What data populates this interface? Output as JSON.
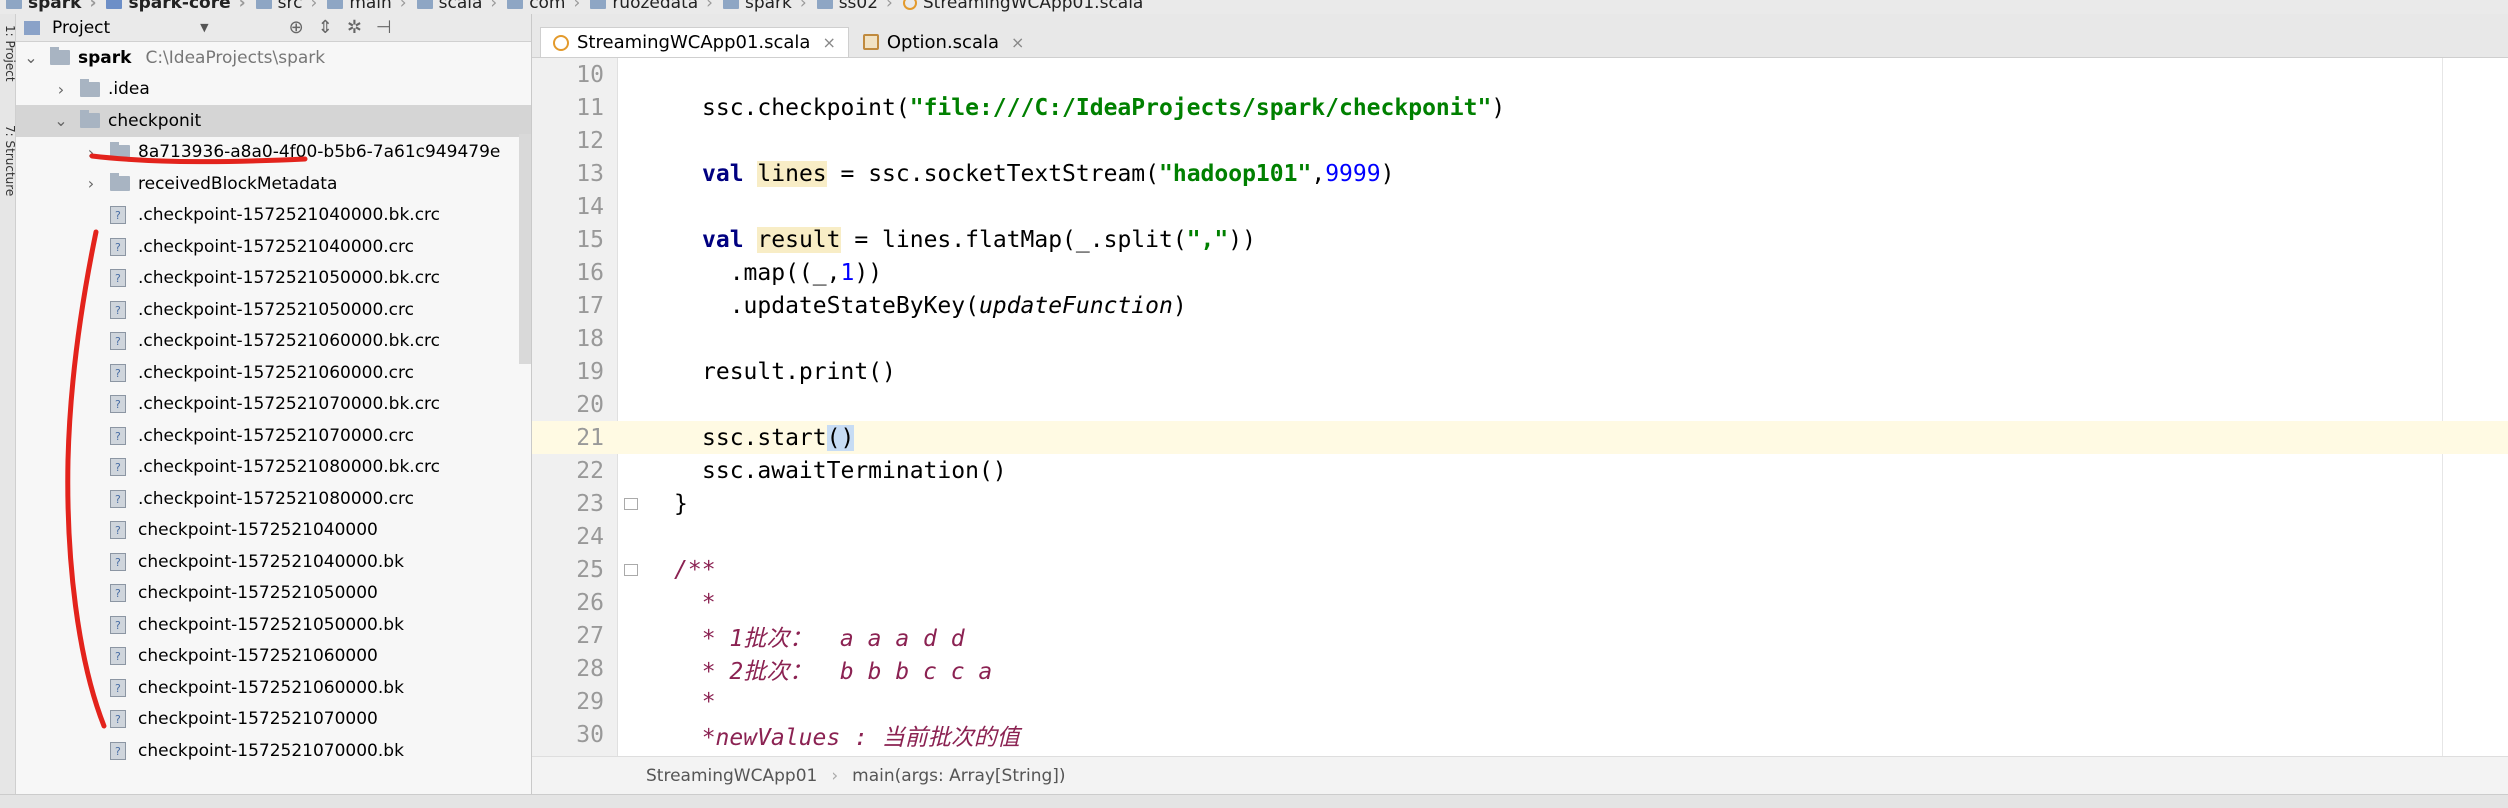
{
  "breadcrumb": [
    {
      "label": "spark",
      "icon": "folder-icon",
      "bold": true
    },
    {
      "label": "spark-core",
      "icon": "module-icon",
      "bold": true
    },
    {
      "label": "src",
      "icon": "folder-icon",
      "bold": false
    },
    {
      "label": "main",
      "icon": "folder-icon",
      "bold": false
    },
    {
      "label": "scala",
      "icon": "folder-icon",
      "bold": false
    },
    {
      "label": "com",
      "icon": "folder-icon",
      "bold": false
    },
    {
      "label": "ruozedata",
      "icon": "folder-icon",
      "bold": false
    },
    {
      "label": "spark",
      "icon": "folder-icon",
      "bold": false
    },
    {
      "label": "ss02",
      "icon": "folder-icon",
      "bold": false
    },
    {
      "label": "StreamingWCApp01.scala",
      "icon": "scala-object-icon",
      "bold": false
    }
  ],
  "toolwindows": {
    "project": "1: Project",
    "structure": "7: Structure"
  },
  "project": {
    "title": "Project",
    "tree": [
      {
        "label": "spark",
        "path": "C:\\IdeaProjects\\spark",
        "type": "module",
        "depth": 0,
        "arrow": "expanded"
      },
      {
        "label": ".idea",
        "type": "folder",
        "depth": 1,
        "arrow": "collapsed"
      },
      {
        "label": "checkponit",
        "type": "folder",
        "depth": 1,
        "arrow": "expanded",
        "selected": true
      },
      {
        "label": "8a713936-a8a0-4f00-b5b6-7a61c949479e",
        "type": "folder",
        "depth": 2,
        "arrow": "collapsed"
      },
      {
        "label": "receivedBlockMetadata",
        "type": "folder",
        "depth": 2,
        "arrow": "collapsed"
      },
      {
        "label": ".checkpoint-1572521040000.bk.crc",
        "type": "file",
        "depth": 2
      },
      {
        "label": ".checkpoint-1572521040000.crc",
        "type": "file",
        "depth": 2
      },
      {
        "label": ".checkpoint-1572521050000.bk.crc",
        "type": "file",
        "depth": 2
      },
      {
        "label": ".checkpoint-1572521050000.crc",
        "type": "file",
        "depth": 2
      },
      {
        "label": ".checkpoint-1572521060000.bk.crc",
        "type": "file",
        "depth": 2
      },
      {
        "label": ".checkpoint-1572521060000.crc",
        "type": "file",
        "depth": 2
      },
      {
        "label": ".checkpoint-1572521070000.bk.crc",
        "type": "file",
        "depth": 2
      },
      {
        "label": ".checkpoint-1572521070000.crc",
        "type": "file",
        "depth": 2
      },
      {
        "label": ".checkpoint-1572521080000.bk.crc",
        "type": "file",
        "depth": 2
      },
      {
        "label": ".checkpoint-1572521080000.crc",
        "type": "file",
        "depth": 2
      },
      {
        "label": "checkpoint-1572521040000",
        "type": "file",
        "depth": 2
      },
      {
        "label": "checkpoint-1572521040000.bk",
        "type": "file",
        "depth": 2
      },
      {
        "label": "checkpoint-1572521050000",
        "type": "file",
        "depth": 2
      },
      {
        "label": "checkpoint-1572521050000.bk",
        "type": "file",
        "depth": 2
      },
      {
        "label": "checkpoint-1572521060000",
        "type": "file",
        "depth": 2
      },
      {
        "label": "checkpoint-1572521060000.bk",
        "type": "file",
        "depth": 2
      },
      {
        "label": "checkpoint-1572521070000",
        "type": "file",
        "depth": 2
      },
      {
        "label": "checkpoint-1572521070000.bk",
        "type": "file",
        "depth": 2
      }
    ]
  },
  "tabs": [
    {
      "label": "StreamingWCApp01.scala",
      "active": true,
      "icon": "scala-object-icon",
      "close": "×"
    },
    {
      "label": "Option.scala",
      "active": false,
      "icon": "scala-file-icon",
      "close": "×"
    }
  ],
  "editor": {
    "current_line": 21,
    "lines": [
      {
        "n": "10",
        "segs": []
      },
      {
        "n": "11",
        "segs": [
          [
            "ssc.checkpoint(",
            ""
          ],
          [
            "\"file:///C:/IdeaProjects/spark/checkponit\"",
            "str"
          ],
          [
            ")",
            ""
          ]
        ]
      },
      {
        "n": "12",
        "segs": []
      },
      {
        "n": "13",
        "segs": [
          [
            "val",
            "kw"
          ],
          [
            " ",
            ""
          ],
          [
            "lines",
            "hl"
          ],
          [
            " = ssc.socketTextStream(",
            ""
          ],
          [
            "\"hadoop101\"",
            "str"
          ],
          [
            ",",
            ""
          ],
          [
            "9999",
            "num"
          ],
          [
            ")",
            ""
          ]
        ]
      },
      {
        "n": "14",
        "segs": []
      },
      {
        "n": "15",
        "segs": [
          [
            "val",
            "kw"
          ],
          [
            " ",
            ""
          ],
          [
            "result",
            "hl"
          ],
          [
            " = lines.flatMap(_.split(",
            ""
          ],
          [
            "\",\"",
            "str"
          ],
          [
            "))",
            ""
          ]
        ]
      },
      {
        "n": "16",
        "segs": [
          [
            "  .map((_,",
            ""
          ],
          [
            "1",
            "num"
          ],
          [
            "))",
            ""
          ]
        ]
      },
      {
        "n": "17",
        "segs": [
          [
            "  .updateStateByKey(",
            ""
          ],
          [
            "updateFunction",
            "ital"
          ],
          [
            ")",
            ""
          ]
        ]
      },
      {
        "n": "18",
        "segs": []
      },
      {
        "n": "19",
        "segs": [
          [
            "result.print()",
            ""
          ]
        ]
      },
      {
        "n": "20",
        "segs": []
      },
      {
        "n": "21",
        "segs": [
          [
            "ssc.start",
            ""
          ],
          [
            "()",
            "sel"
          ]
        ]
      },
      {
        "n": "22",
        "segs": [
          [
            "ssc.awaitTermination()",
            ""
          ]
        ]
      },
      {
        "n": "23",
        "indent": -2,
        "segs": [
          [
            "}",
            ""
          ]
        ]
      },
      {
        "n": "24",
        "segs": []
      },
      {
        "n": "25",
        "indent": -2,
        "segs": [
          [
            "/**",
            "doc"
          ]
        ]
      },
      {
        "n": "26",
        "indent": -2,
        "segs": [
          [
            "  *",
            "doc"
          ]
        ]
      },
      {
        "n": "27",
        "indent": -2,
        "segs": [
          [
            "  * 1批次：  a a a d d",
            "doc"
          ]
        ]
      },
      {
        "n": "28",
        "indent": -2,
        "segs": [
          [
            "  * 2批次：  b b b c c a",
            "doc"
          ]
        ]
      },
      {
        "n": "29",
        "indent": -2,
        "segs": [
          [
            "  *",
            "doc"
          ]
        ]
      },
      {
        "n": "30",
        "indent": -2,
        "segs": [
          [
            "  *newValues : 当前批次的值",
            "doc"
          ]
        ]
      }
    ]
  },
  "editor_breadcrumb": [
    "StreamingWCApp01",
    "main(args: Array[String])"
  ],
  "colors": {
    "annotation": "#e3231c",
    "keyword": "#000080",
    "string": "#008000",
    "number": "#0000ff",
    "doc": "#8b2252"
  }
}
